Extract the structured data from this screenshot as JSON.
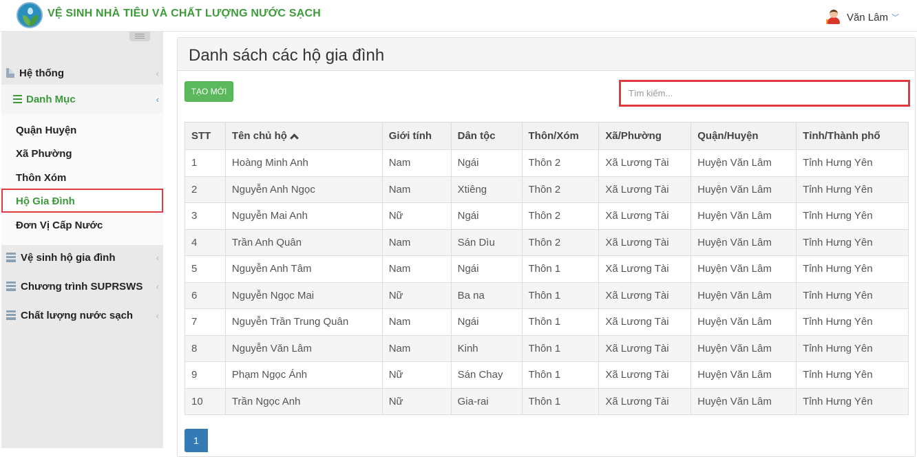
{
  "header": {
    "app_title": "VỆ SINH NHÀ TIÊU VÀ CHẤT LƯỢNG NƯỚC SẠCH",
    "user_name": "Văn Lâm",
    "user_chevron": "﹀"
  },
  "sidebar": {
    "items": [
      {
        "label": "Hệ thống",
        "icon": "file-icon"
      },
      {
        "label": "Danh Mục",
        "icon": "bars-icon"
      },
      {
        "label": "Vệ sinh hộ gia đình",
        "icon": "server-icon"
      },
      {
        "label": "Chương trình SUPRSWS",
        "icon": "server-icon"
      },
      {
        "label": "Chất lượng nước sạch",
        "icon": "server-icon"
      }
    ],
    "sub_items": [
      {
        "label": "Quận Huyện"
      },
      {
        "label": "Xã Phường"
      },
      {
        "label": "Thôn Xóm"
      },
      {
        "label": "Hộ Gia Đình"
      },
      {
        "label": "Đơn Vị Cấp Nước"
      }
    ],
    "caret": "‹"
  },
  "main": {
    "title": "Danh sách các hộ gia đình",
    "create_button": "TẠO MỚI",
    "search_placeholder": "Tìm kiếm...",
    "columns": [
      "STT",
      "Tên chủ hộ",
      "Giới tính",
      "Dân tộc",
      "Thôn/Xóm",
      "Xã/Phường",
      "Quận/Huyện",
      "Tỉnh/Thành phố"
    ],
    "rows": [
      [
        "1",
        "Hoàng Minh Anh",
        "Nam",
        "Ngái",
        "Thôn 2",
        "Xã Lương Tài",
        "Huyện Văn Lâm",
        "Tỉnh Hưng Yên"
      ],
      [
        "2",
        "Nguyễn Anh Ngọc",
        "Nam",
        "Xtiêng",
        "Thôn 2",
        "Xã Lương Tài",
        "Huyện Văn Lâm",
        "Tỉnh Hưng Yên"
      ],
      [
        "3",
        "Nguyễn Mai Anh",
        "Nữ",
        "Ngái",
        "Thôn 2",
        "Xã Lương Tài",
        "Huyện Văn Lâm",
        "Tỉnh Hưng Yên"
      ],
      [
        "4",
        "Trần Anh Quân",
        "Nam",
        "Sán Dìu",
        "Thôn 2",
        "Xã Lương Tài",
        "Huyện Văn Lâm",
        "Tỉnh Hưng Yên"
      ],
      [
        "5",
        "Nguyễn Anh Tâm",
        "Nam",
        "Ngái",
        "Thôn 1",
        "Xã Lương Tài",
        "Huyện Văn Lâm",
        "Tỉnh Hưng Yên"
      ],
      [
        "6",
        "Nguyễn Ngọc Mai",
        "Nữ",
        "Ba na",
        "Thôn 1",
        "Xã Lương Tài",
        "Huyện Văn Lâm",
        "Tỉnh Hưng Yên"
      ],
      [
        "7",
        "Nguyễn Trần Trung Quân",
        "Nam",
        "Ngái",
        "Thôn 1",
        "Xã Lương Tài",
        "Huyện Văn Lâm",
        "Tỉnh Hưng Yên"
      ],
      [
        "8",
        "Nguyễn Văn Lâm",
        "Nam",
        "Kinh",
        "Thôn 1",
        "Xã Lương Tài",
        "Huyện Văn Lâm",
        "Tỉnh Hưng Yên"
      ],
      [
        "9",
        "Phạm Ngọc Ánh",
        "Nữ",
        "Sán Chay",
        "Thôn 1",
        "Xã Lương Tài",
        "Huyện Văn Lâm",
        "Tỉnh Hưng Yên"
      ],
      [
        "10",
        "Trần Ngọc Anh",
        "Nữ",
        "Gia-rai",
        "Thôn 1",
        "Xã Lương Tài",
        "Huyện Văn Lâm",
        "Tỉnh Hưng Yên"
      ]
    ],
    "pagination": {
      "current_page": "1"
    }
  },
  "colors": {
    "brand_green": "#3e9a3b",
    "button_green": "#5cb85c",
    "highlight_red": "#e0393e",
    "page_blue": "#337ab7"
  }
}
